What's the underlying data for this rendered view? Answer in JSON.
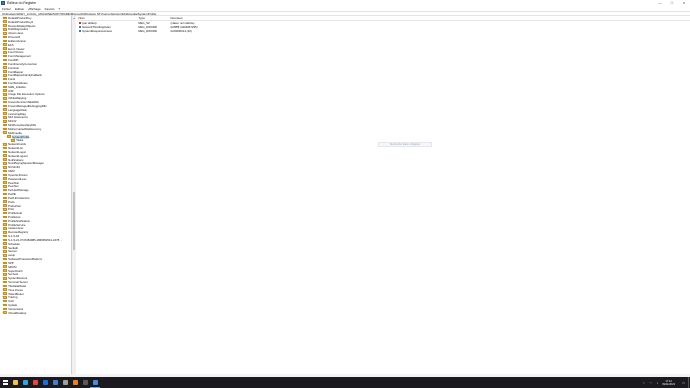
{
  "window": {
    "title": "Éditeur du Registre",
    "controls": [
      "—",
      "☐",
      "✕"
    ]
  },
  "menu": [
    "Fichier",
    "Edition",
    "Affichage",
    "Favoris",
    "?"
  ],
  "address": "Ordinateur\\HKEY_LOCAL_MACHINE\\SOFTWARE\\Microsoft\\Windows NT\\CurrentVersion\\Multimedia\\SystemProfile",
  "tree": {
    "items": [
      {
        "label": "DefaultProductKey",
        "expander": "›"
      },
      {
        "label": "DefaultProductKey2",
        "expander": "›"
      },
      {
        "label": "DeviceDisplayObjects",
        "expander": "›"
      },
      {
        "label": "DiskDiagnostics",
        "expander": "›"
      },
      {
        "label": "drivers.desc",
        "expander": ""
      },
      {
        "label": "Drivers32",
        "expander": "›"
      },
      {
        "label": "EditionVersion",
        "expander": ""
      },
      {
        "label": "EFS",
        "expander": "›"
      },
      {
        "label": "Event Viewer",
        "expander": "›"
      },
      {
        "label": "Font Drivers",
        "expander": ""
      },
      {
        "label": "Font Management",
        "expander": "›"
      },
      {
        "label": "FontDPI",
        "expander": ""
      },
      {
        "label": "FontIntensityCorrection",
        "expander": ""
      },
      {
        "label": "FontLink",
        "expander": "›"
      },
      {
        "label": "FontMapper",
        "expander": ""
      },
      {
        "label": "FontMapperFamilyFallback",
        "expander": ""
      },
      {
        "label": "Fonts",
        "expander": ""
      },
      {
        "label": "FontSubstitutes",
        "expander": ""
      },
      {
        "label": "GRE_Initialize",
        "expander": ""
      },
      {
        "label": "ICM",
        "expander": "›"
      },
      {
        "label": "Image File Execution Options",
        "expander": "›"
      },
      {
        "label": "IniFileMapping",
        "expander": "›"
      },
      {
        "label": "KnownFunctionTableDlls",
        "expander": ""
      },
      {
        "label": "KnownManagedDebuggingDlls",
        "expander": ""
      },
      {
        "label": "LanguagePack",
        "expander": "›"
      },
      {
        "label": "LicensingDiag",
        "expander": "›"
      },
      {
        "label": "MCI Extensions",
        "expander": ""
      },
      {
        "label": "MCI32",
        "expander": ""
      },
      {
        "label": "MiniDumpAuxiliaryDlls",
        "expander": ""
      },
      {
        "label": "MsiCorruptedFileRecovery",
        "expander": "›"
      },
      {
        "label": "Multimedia",
        "expander": "⌄"
      },
      {
        "label": "SystemProfile",
        "expander": "⌄",
        "indent": 1,
        "selected": true
      },
      {
        "label": "Tasks",
        "expander": "›",
        "indent": 2
      },
      {
        "label": "NetworkCards",
        "expander": "›"
      },
      {
        "label": "NetworkList",
        "expander": "›"
      },
      {
        "label": "NetworkLogon",
        "expander": "›"
      },
      {
        "label": "NetworkLogon2",
        "expander": "›"
      },
      {
        "label": "Notifications",
        "expander": "›"
      },
      {
        "label": "NowPlayingSessionManager",
        "expander": "›"
      },
      {
        "label": "NtVdm64",
        "expander": "›"
      },
      {
        "label": "OEM",
        "expander": "›"
      },
      {
        "label": "OpenGLDrivers",
        "expander": "›"
      },
      {
        "label": "PasswordLess",
        "expander": "›"
      },
      {
        "label": "PeerDist",
        "expander": "›"
      },
      {
        "label": "PeerNet",
        "expander": "›"
      },
      {
        "label": "PerHwIdStorage",
        "expander": ""
      },
      {
        "label": "Perflib",
        "expander": "›"
      },
      {
        "label": "PerfLibCollectors",
        "expander": ""
      },
      {
        "label": "Ports",
        "expander": ""
      },
      {
        "label": "Prefetcher",
        "expander": ""
      },
      {
        "label": "Print",
        "expander": "›"
      },
      {
        "label": "ProfileGuid",
        "expander": ""
      },
      {
        "label": "ProfileList",
        "expander": "›"
      },
      {
        "label": "ProfileNotification",
        "expander": "›"
      },
      {
        "label": "ProfileService",
        "expander": "›"
      },
      {
        "label": "related.desc",
        "expander": ""
      },
      {
        "label": "RemoteRegistry",
        "expander": "›"
      },
      {
        "label": "S-1-5-18",
        "expander": "›"
      },
      {
        "label": "S-1-5-21-3747284985-1869652513-2478…",
        "expander": "›"
      },
      {
        "label": "Schedule",
        "expander": "›"
      },
      {
        "label": "SecEdit",
        "expander": "›"
      },
      {
        "label": "Sensor",
        "expander": "›"
      },
      {
        "label": "setup",
        "expander": "›"
      },
      {
        "label": "SoftwareProtectionPlatform",
        "expander": "›"
      },
      {
        "label": "SPP",
        "expander": "›"
      },
      {
        "label": "SRUM",
        "expander": "›"
      },
      {
        "label": "SuperFetch",
        "expander": "›"
      },
      {
        "label": "Svchost",
        "expander": "›"
      },
      {
        "label": "SystemRestore",
        "expander": "›"
      },
      {
        "label": "Terminal Server",
        "expander": "›"
      },
      {
        "label": "TileDataModel",
        "expander": "›"
      },
      {
        "label": "Time Zones",
        "expander": "›"
      },
      {
        "label": "TokenBroker",
        "expander": "›"
      },
      {
        "label": "Tracing",
        "expander": "›"
      },
      {
        "label": "UAC",
        "expander": "›"
      },
      {
        "label": "Update",
        "expander": "›"
      },
      {
        "label": "VersionsList",
        "expander": ""
      },
      {
        "label": "VirtualDesktop",
        "expander": "›"
      }
    ]
  },
  "list": {
    "headers": {
      "name": "Nom",
      "type": "Type",
      "data": "Données"
    },
    "rows": [
      {
        "icon": "string-value-icon",
        "name": "(par défaut)",
        "type": "REG_SZ",
        "data": "(valeur non définie)"
      },
      {
        "icon": "dword-value-icon",
        "name": "NetworkThrottlingIndex",
        "type": "REG_DWORD",
        "data": "0xffffffff (4294967295)"
      },
      {
        "icon": "dword-value-icon",
        "name": "SystemResponsiveness",
        "type": "REG_DWORD",
        "data": "0x00000014 (20)"
      }
    ]
  },
  "tooltip": "Rechercher dans le Registre",
  "taskbar": {
    "apps": [
      {
        "name": "file-explorer-icon",
        "color": "#f2c14e"
      },
      {
        "name": "edge-browser-icon",
        "color": "#2ea7e0"
      },
      {
        "name": "chrome-browser-icon",
        "color": "#e8453c"
      },
      {
        "name": "mail-icon",
        "color": "#1f6fd6"
      },
      {
        "name": "store-icon",
        "color": "#3f7fd9"
      },
      {
        "name": "settings-icon",
        "color": "#9aa0a6"
      },
      {
        "name": "media-player-icon",
        "color": "#f07f23"
      },
      {
        "name": "terminal-icon",
        "color": "#5a5a5a"
      },
      {
        "name": "regedit-icon",
        "color": "#4c8bd6",
        "active": true
      }
    ],
    "time": "17:12",
    "date": "09/11/2023"
  },
  "accent": "#0078d7"
}
